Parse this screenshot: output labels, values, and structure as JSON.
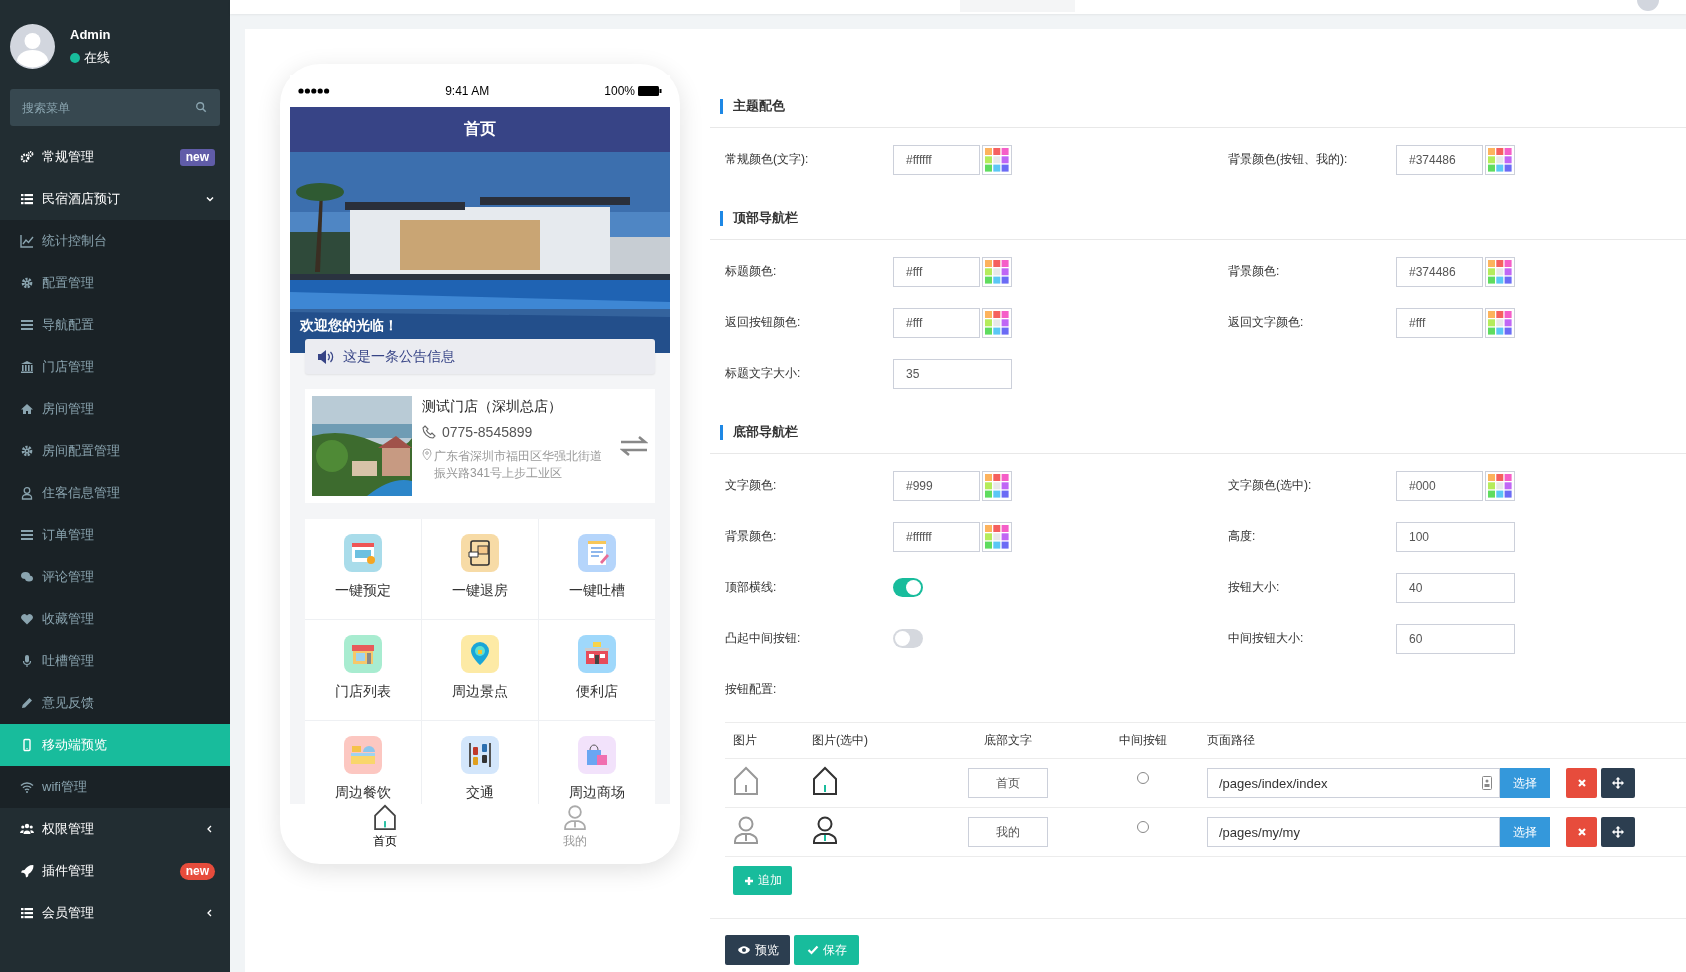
{
  "sidebar": {
    "user": {
      "name": "Admin",
      "status": "在线"
    },
    "search": {
      "placeholder": "搜索菜单"
    },
    "menu": [
      {
        "label": "常规管理",
        "selected": false,
        "badge": {
          "text": "new",
          "color": "#605ca8"
        }
      },
      {
        "label": "民宿酒店预订",
        "selected": false,
        "expanded": true,
        "children": [
          {
            "label": "统计控制台",
            "selected": false
          },
          {
            "label": "配置管理",
            "selected": false
          },
          {
            "label": "导航配置",
            "selected": false
          },
          {
            "label": "门店管理",
            "selected": false
          },
          {
            "label": "房间管理",
            "selected": false
          },
          {
            "label": "房间配置管理",
            "selected": false
          },
          {
            "label": "住客信息管理",
            "selected": false
          },
          {
            "label": "订单管理",
            "selected": false
          },
          {
            "label": "评论管理",
            "selected": false
          },
          {
            "label": "收藏管理",
            "selected": false
          },
          {
            "label": "吐槽管理",
            "selected": false
          },
          {
            "label": "意见反馈",
            "selected": false
          },
          {
            "label": "移动端预览",
            "selected": true
          },
          {
            "label": "wifi管理",
            "selected": false
          }
        ]
      },
      {
        "label": "权限管理",
        "selected": false,
        "expanded": false
      },
      {
        "label": "插件管理",
        "selected": false,
        "badge": {
          "text": "new",
          "color": "#e74c3c"
        }
      },
      {
        "label": "会员管理",
        "selected": false,
        "expanded": false
      }
    ]
  },
  "phone": {
    "status_bar": {
      "time": "9:41 AM",
      "battery": "100%"
    },
    "nav_title": "首页",
    "banner": {
      "kind": "picture",
      "caption": "欢迎您的光临！"
    },
    "notice": "这是一条公告信息",
    "store": {
      "name": "测试门店（深圳总店）",
      "phone": "0775-8545899",
      "address": "广东省深圳市福田区华强北街道振兴路341号上步工业区"
    },
    "shortcuts": [
      {
        "label": "一键预定"
      },
      {
        "label": "一键退房"
      },
      {
        "label": "一键吐槽"
      },
      {
        "label": "门店列表"
      },
      {
        "label": "周边景点"
      },
      {
        "label": "便利店"
      },
      {
        "label": "周边餐饮"
      },
      {
        "label": "交通"
      },
      {
        "label": "周边商场"
      }
    ],
    "tabbar": [
      {
        "label": "首页",
        "selected": true
      },
      {
        "label": "我的",
        "selected": false
      }
    ]
  },
  "form": {
    "sections": [
      {
        "title": "主题配色",
        "fields": [
          {
            "label": "常规颜色(文字):",
            "kind": "color",
            "value": "#ffffff"
          },
          {
            "label": "背景颜色(按钮、我的):",
            "kind": "color",
            "value": "#374486"
          }
        ]
      },
      {
        "title": "顶部导航栏",
        "fields": [
          {
            "label": "标题颜色:",
            "kind": "color",
            "value": "#fff"
          },
          {
            "label": "背景颜色:",
            "kind": "color",
            "value": "#374486"
          },
          {
            "label": "返回按钮颜色:",
            "kind": "color",
            "value": "#fff"
          },
          {
            "label": "返回文字颜色:",
            "kind": "color",
            "value": "#fff"
          },
          {
            "label": "标题文字大小:",
            "kind": "text",
            "value": "35"
          }
        ]
      },
      {
        "title": "底部导航栏",
        "fields": [
          {
            "label": "文字颜色:",
            "kind": "color",
            "value": "#999"
          },
          {
            "label": "文字颜色(选中):",
            "kind": "color",
            "value": "#000"
          },
          {
            "label": "背景颜色:",
            "kind": "color",
            "value": "#ffffff"
          },
          {
            "label": "高度:",
            "kind": "text",
            "value": "100"
          },
          {
            "label": "顶部横线:",
            "kind": "switch",
            "on": true
          },
          {
            "label": "按钮大小:",
            "kind": "text",
            "value": "40"
          },
          {
            "label": "凸起中间按钮:",
            "kind": "switch",
            "on": false
          },
          {
            "label": "中间按钮大小:",
            "kind": "text",
            "value": "60"
          },
          {
            "label": "按钮配置:",
            "kind": "label"
          }
        ]
      }
    ],
    "button_table": {
      "columns": [
        "图片",
        "图片(选中)",
        "底部文字",
        "中间按钮",
        "页面路径"
      ],
      "rows": [
        {
          "kind": "home",
          "text": "首页",
          "center": false,
          "path": "/pages/index/index",
          "picker": true,
          "choose": "选择"
        },
        {
          "kind": "user",
          "text": "我的",
          "center": false,
          "path": "/pages/my/my",
          "picker": false,
          "choose": "选择"
        }
      ]
    },
    "add_button": "追加",
    "actions": [
      {
        "kind": "preview",
        "label": "预览"
      },
      {
        "kind": "save",
        "label": "保存"
      }
    ]
  }
}
